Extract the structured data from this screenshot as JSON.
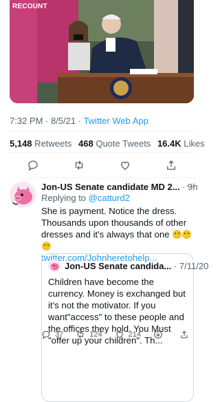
{
  "media": {
    "watermark": "RECOUNT"
  },
  "tweet": {
    "time": "7:32 PM · 8/5/21 · ",
    "app": "Twitter Web App",
    "stats": {
      "retweets_count": "5,148",
      "retweets_label": "Retweets",
      "quote_count": "468",
      "quote_label": "Quote Tweets",
      "likes_count": "16.4K",
      "likes_label": "Likes"
    }
  },
  "reply": {
    "name": "Jon-US Senate candidate MD 2...",
    "time": "· 9h",
    "more": "···",
    "replying_prefix": "Replying to ",
    "replying_handle": "@catturd2",
    "text": "She is payment. Notice the dress. Thousands upon thousands of other dresses and it's always that one ",
    "link": "twitter.com/Johnheretohelp...",
    "actions": {
      "reply_count": "37",
      "retweet_count": "124",
      "like_count": "214"
    }
  },
  "quote": {
    "name": "Jon-US Senate candida...",
    "time": "· 7/11/20",
    "text": "Children have become the currency. Money is exchanged but it's not the motivator. If you want\"access\" to these people and the offices they hold. You Must \"offer up your children\". Th..."
  },
  "colors": {
    "accent": "#1d9bf0",
    "muted": "#536471",
    "text": "#0f1419",
    "border": "#cfd9de"
  }
}
